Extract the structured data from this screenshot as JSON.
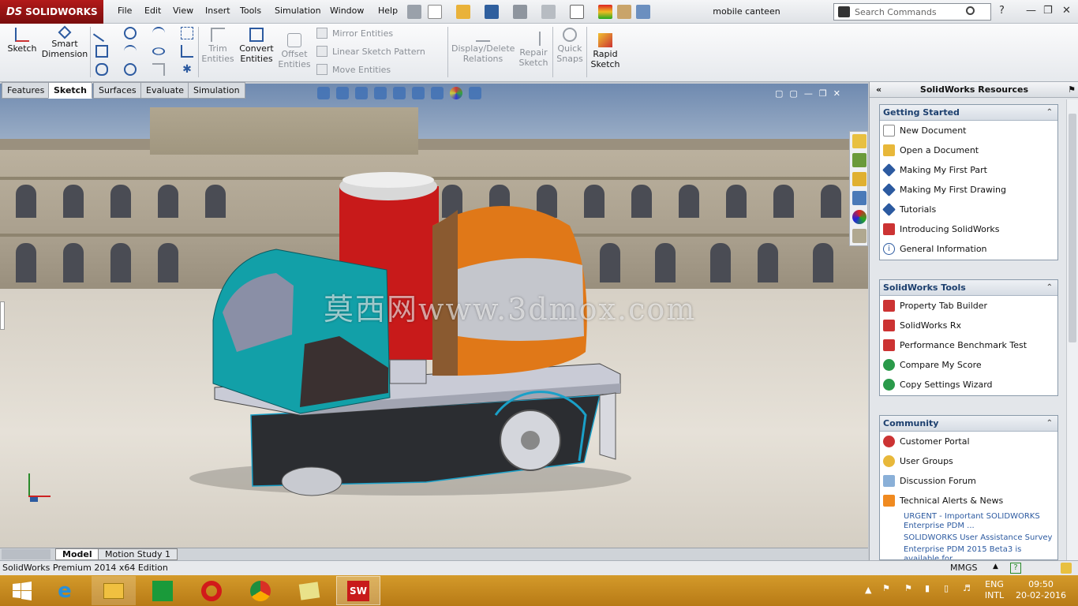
{
  "app": {
    "logo_prefix": "DS",
    "logo_text": "SOLIDWORKS",
    "document_title": "mobile canteen"
  },
  "menu": [
    "File",
    "Edit",
    "View",
    "Insert",
    "Tools",
    "Simulation",
    "Window",
    "Help"
  ],
  "search": {
    "placeholder": "Search Commands"
  },
  "ribbon": {
    "sketch": "Sketch",
    "smart_dimension": [
      "Smart",
      "Dimension"
    ],
    "trim": [
      "Trim",
      "Entities"
    ],
    "convert": [
      "Convert",
      "Entities"
    ],
    "offset": [
      "Offset",
      "Entities"
    ],
    "mirror": "Mirror Entities",
    "linear_pattern": "Linear Sketch Pattern",
    "move": "Move Entities",
    "display_relations": [
      "Display/Delete",
      "Relations"
    ],
    "repair": [
      "Repair",
      "Sketch"
    ],
    "quick_snaps": [
      "Quick",
      "Snaps"
    ],
    "rapid_sketch": [
      "Rapid",
      "Sketch"
    ]
  },
  "cm_tabs": [
    "Features",
    "Sketch",
    "Surfaces",
    "Evaluate",
    "Simulation"
  ],
  "watermark": "莫西网www.3dmox.com",
  "bottom_tabs": [
    "Model",
    "Motion Study 1"
  ],
  "status": {
    "edition": "SolidWorks Premium 2014 x64 Edition",
    "units": "MMGS"
  },
  "taskpane": {
    "title": "SolidWorks Resources",
    "groups": [
      {
        "title": "Getting Started",
        "items": [
          "New Document",
          "Open a Document",
          "Making My First Part",
          "Making My First Drawing",
          "Tutorials",
          "Introducing SolidWorks",
          "General Information"
        ]
      },
      {
        "title": "SolidWorks Tools",
        "items": [
          "Property Tab Builder",
          "SolidWorks Rx",
          "Performance Benchmark Test",
          "Compare My Score",
          "Copy Settings Wizard"
        ]
      },
      {
        "title": "Community",
        "items": [
          "Customer Portal",
          "User Groups",
          "Discussion Forum",
          "Technical Alerts & News"
        ]
      }
    ],
    "news": [
      "URGENT - Important SOLIDWORKS Enterprise PDM ...",
      "SOLIDWORKS User Assistance Survey",
      "Enterprise PDM 2015 Beta3 is available for"
    ]
  },
  "taskbar": {
    "lang": "ENG",
    "layout": "INTL",
    "time": "09:50",
    "date": "20-02-2016"
  }
}
